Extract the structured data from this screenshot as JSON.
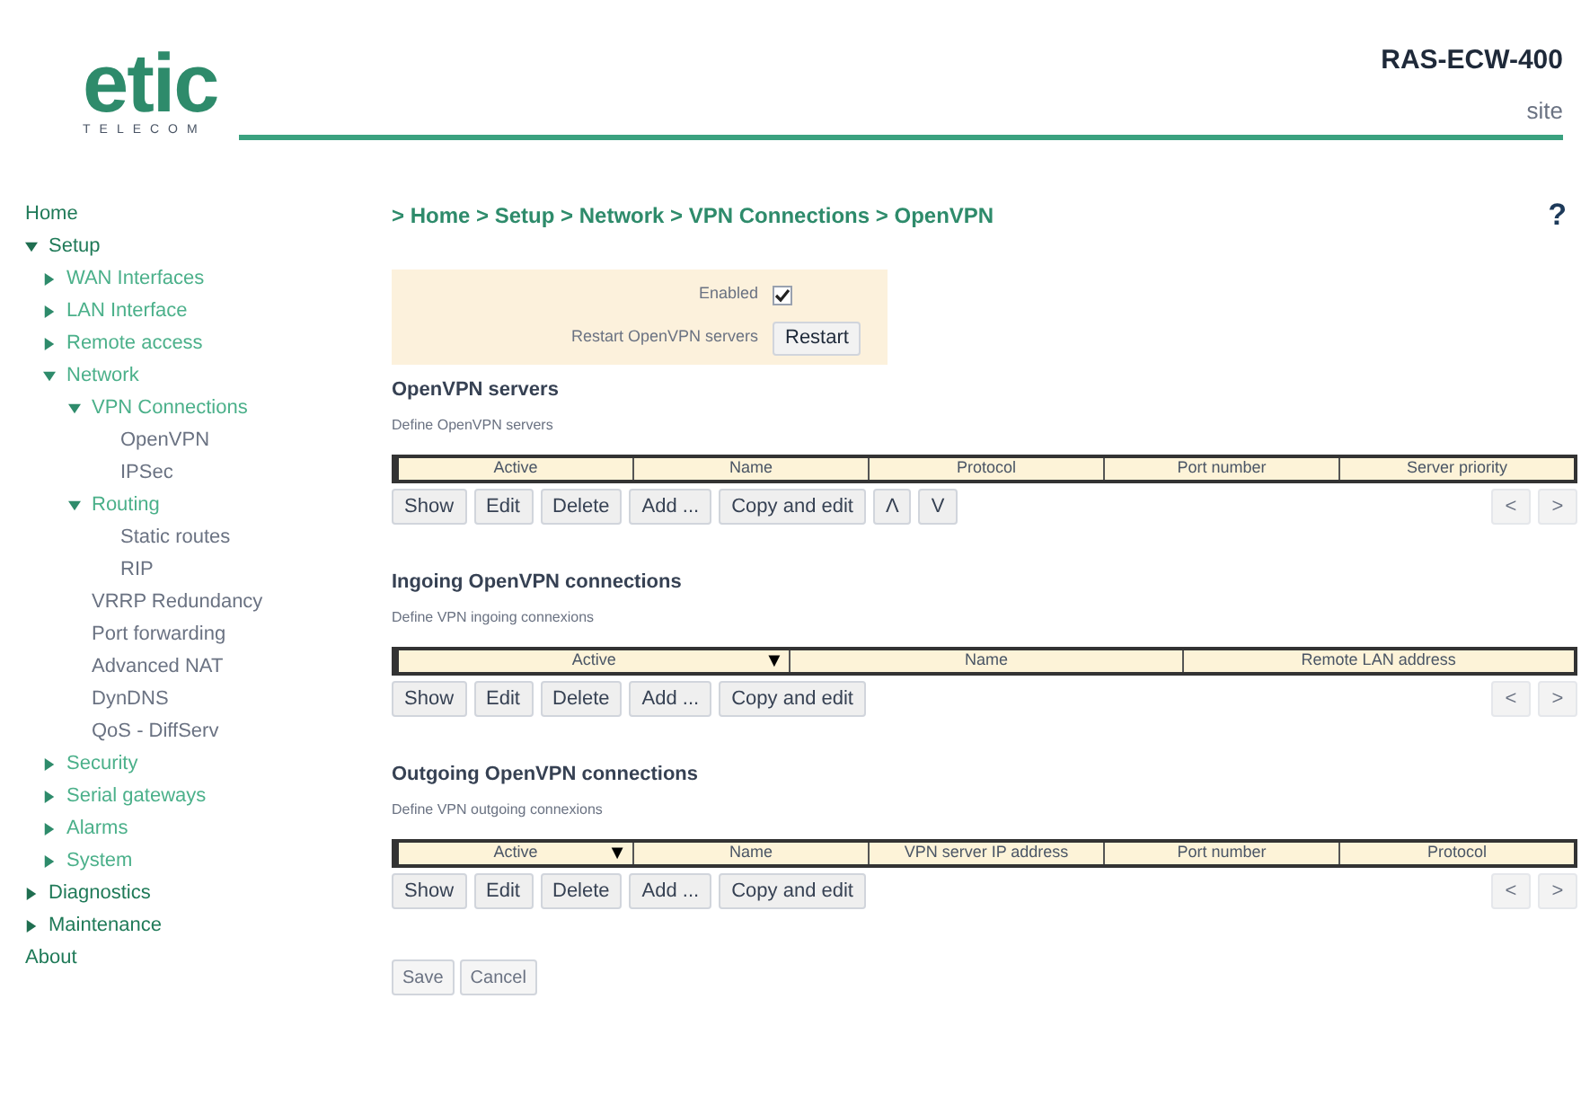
{
  "header": {
    "logo": {
      "text": "etic",
      "subtext": "TELECOM"
    },
    "device": "RAS-ECW-400",
    "site": "site"
  },
  "sidebar": {
    "items": [
      {
        "label": "Home"
      },
      {
        "label": "Setup",
        "expanded": true,
        "children": [
          {
            "label": "WAN Interfaces",
            "expanded": false
          },
          {
            "label": "LAN Interface",
            "expanded": false
          },
          {
            "label": "Remote access",
            "expanded": false
          },
          {
            "label": "Network",
            "expanded": true,
            "children": [
              {
                "label": "VPN Connections",
                "expanded": true,
                "children": [
                  {
                    "label": "OpenVPN"
                  },
                  {
                    "label": "IPSec"
                  }
                ]
              },
              {
                "label": "Routing",
                "expanded": true,
                "children": [
                  {
                    "label": "Static routes"
                  },
                  {
                    "label": "RIP"
                  }
                ]
              },
              {
                "label": "VRRP Redundancy"
              },
              {
                "label": "Port forwarding"
              },
              {
                "label": "Advanced NAT"
              },
              {
                "label": "DynDNS"
              },
              {
                "label": "QoS - DiffServ"
              }
            ]
          },
          {
            "label": "Security",
            "expanded": false
          },
          {
            "label": "Serial gateways",
            "expanded": false
          },
          {
            "label": "Alarms",
            "expanded": false
          },
          {
            "label": "System",
            "expanded": false
          }
        ]
      },
      {
        "label": "Diagnostics",
        "expanded": false
      },
      {
        "label": "Maintenance",
        "expanded": false
      },
      {
        "label": "About"
      }
    ]
  },
  "breadcrumb": "> Home > Setup > Network > VPN Connections > OpenVPN",
  "help": "?",
  "settings": {
    "enabled_label": "Enabled",
    "enabled": true,
    "restart_label": "Restart OpenVPN servers",
    "restart_button": "Restart"
  },
  "sections": [
    {
      "title": "OpenVPN servers",
      "description": "Define OpenVPN servers",
      "columns": [
        {
          "label": "Active"
        },
        {
          "label": "Name"
        },
        {
          "label": "Protocol"
        },
        {
          "label": "Port number"
        },
        {
          "label": "Server priority"
        }
      ],
      "buttons": [
        "Show",
        "Edit",
        "Delete",
        "Add ...",
        "Copy and edit",
        "Λ",
        "V"
      ],
      "nav": [
        {
          "label": "<",
          "disabled": true
        },
        {
          "label": ">",
          "disabled": true
        }
      ]
    },
    {
      "title": "Ingoing OpenVPN connections",
      "description": "Define VPN ingoing connexions",
      "columns": [
        {
          "label": "Active",
          "sort": "▼"
        },
        {
          "label": "Name"
        },
        {
          "label": "Remote LAN address"
        }
      ],
      "buttons": [
        "Show",
        "Edit",
        "Delete",
        "Add ...",
        "Copy and edit"
      ],
      "nav": [
        {
          "label": "<",
          "disabled": true
        },
        {
          "label": ">",
          "disabled": true
        }
      ]
    },
    {
      "title": "Outgoing OpenVPN connections",
      "description": "Define VPN outgoing connexions",
      "columns": [
        {
          "label": "Active",
          "sort": "▼"
        },
        {
          "label": "Name"
        },
        {
          "label": "VPN server IP address"
        },
        {
          "label": "Port number"
        },
        {
          "label": "Protocol"
        }
      ],
      "buttons": [
        "Show",
        "Edit",
        "Delete",
        "Add ...",
        "Copy and edit"
      ],
      "nav": [
        {
          "label": "<",
          "disabled": true
        },
        {
          "label": ">",
          "disabled": true
        }
      ]
    }
  ],
  "footer_buttons": [
    {
      "label": "Save",
      "disabled": true
    },
    {
      "label": "Cancel",
      "disabled": true
    }
  ]
}
